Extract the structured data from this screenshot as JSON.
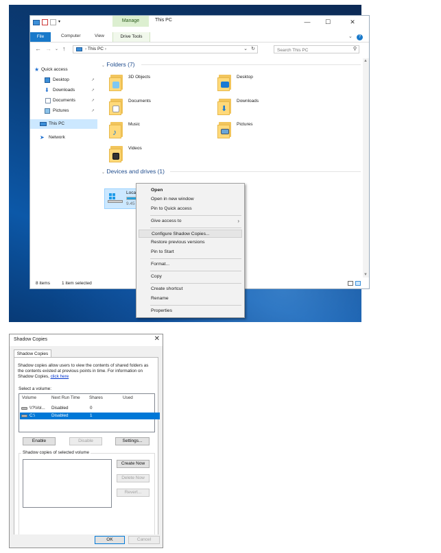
{
  "explorer": {
    "window_title": "This PC",
    "manage_tab": "Manage",
    "ribbon": {
      "file": "File",
      "computer": "Computer",
      "view": "View",
      "drive_tools": "Drive Tools"
    },
    "address": {
      "path": "This PC",
      "separator": "›"
    },
    "search": {
      "placeholder": "Search This PC"
    },
    "nav": {
      "quick_access": "Quick access",
      "items": [
        "Desktop",
        "Downloads",
        "Documents",
        "Pictures"
      ],
      "this_pc": "This PC",
      "network": "Network"
    },
    "folders_header": "Folders (7)",
    "folders": [
      "3D Objects",
      "Desktop",
      "Documents",
      "Downloads",
      "Music",
      "Pictures",
      "Videos"
    ],
    "devices_header": "Devices and drives (1)",
    "drive": {
      "name": "Local Disk (C:)",
      "free_prefix": "9.45 GB",
      "used_fraction": 0.62
    },
    "status": {
      "items": "8 items",
      "selected": "1 item selected"
    }
  },
  "context_menu": {
    "items": [
      {
        "label": "Open",
        "bold": true
      },
      {
        "label": "Open in new window"
      },
      {
        "label": "Pin to Quick access"
      },
      {
        "label": "Give access to",
        "submenu": true
      },
      {
        "label": "Configure Shadow Copies...",
        "highlighted": true
      },
      {
        "label": "Restore previous versions"
      },
      {
        "label": "Pin to Start"
      },
      {
        "label": "Format..."
      },
      {
        "label": "Copy"
      },
      {
        "label": "Create shortcut"
      },
      {
        "label": "Rename"
      },
      {
        "label": "Properties"
      }
    ]
  },
  "dialog": {
    "title": "Shadow Copies",
    "tab": "Shadow Copies",
    "description": "Shadow copies allow users to view the contents of shared folders as the contents existed at previous points in time. For information on Shadow Copies,",
    "link": "click here",
    "select_volume": "Select a volume:",
    "columns": [
      "Volume",
      "Next Run Time",
      "Shares",
      "Used"
    ],
    "volumes": [
      {
        "volume": "\\\\?\\Vol...",
        "next_run": "Disabled",
        "shares": "0",
        "used": ""
      },
      {
        "volume": "C:\\",
        "next_run": "Disabled",
        "shares": "1",
        "used": ""
      }
    ],
    "buttons": {
      "enable": "Enable",
      "disable": "Disable",
      "settings": "Settings...",
      "create_now": "Create Now",
      "delete_now": "Delete Now",
      "revert": "Revert...",
      "ok": "OK",
      "cancel": "Cancel"
    },
    "group_label": "Shadow copies of selected volume"
  },
  "colors": {
    "accent": "#0078d7",
    "file_tab": "#1979ca",
    "manage": "#dcefd0",
    "section": "#1e4b8c"
  }
}
